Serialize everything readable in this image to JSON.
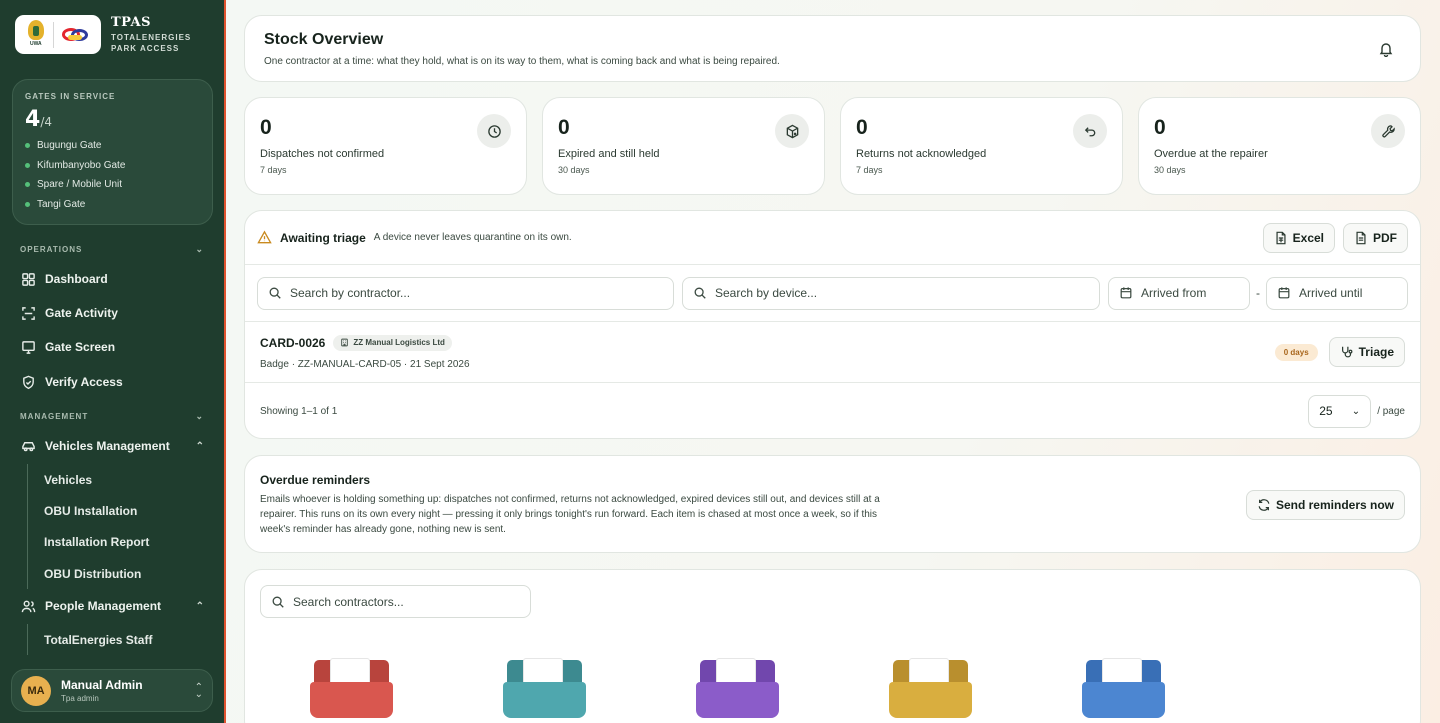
{
  "brand": {
    "title": "TPAS",
    "subtitle_line1": "TOTALENERGIES",
    "subtitle_line2": "PARK ACCESS",
    "uwa_text": "UWA"
  },
  "gates": {
    "label": "GATES IN SERVICE",
    "count": "4",
    "total": "/4",
    "items": [
      "Bugungu Gate",
      "Kifumbanyobo Gate",
      "Spare / Mobile Unit",
      "Tangi Gate"
    ]
  },
  "nav": {
    "operations_label": "OPERATIONS",
    "operations": [
      {
        "label": "Dashboard",
        "icon": "grid-icon"
      },
      {
        "label": "Gate Activity",
        "icon": "scan-icon"
      },
      {
        "label": "Gate Screen",
        "icon": "monitor-icon"
      },
      {
        "label": "Verify Access",
        "icon": "shield-check-icon"
      }
    ],
    "management_label": "MANAGEMENT",
    "vehicles_label": "Vehicles Management",
    "vehicles_items": [
      "Vehicles",
      "OBU Installation",
      "Installation Report",
      "OBU Distribution"
    ],
    "people_label": "People Management",
    "people_items": [
      "TotalEnergies Staff"
    ]
  },
  "user": {
    "initials": "MA",
    "name": "Manual Admin",
    "role": "Tpa admin"
  },
  "header": {
    "title": "Stock Overview",
    "subtitle": "One contractor at a time: what they hold, what is on its way to them, what is coming back and what is being repaired."
  },
  "stats": [
    {
      "value": "0",
      "label": "Dispatches not confirmed",
      "period": "7 days",
      "icon": "clock-icon"
    },
    {
      "value": "0",
      "label": "Expired and still held",
      "period": "30 days",
      "icon": "package-x-icon"
    },
    {
      "value": "0",
      "label": "Returns not acknowledged",
      "period": "7 days",
      "icon": "undo-icon"
    },
    {
      "value": "0",
      "label": "Overdue at the repairer",
      "period": "30 days",
      "icon": "wrench-icon"
    }
  ],
  "triage": {
    "title": "Awaiting triage",
    "description": "A device never leaves quarantine on its own.",
    "excel_label": "Excel",
    "pdf_label": "PDF",
    "search_contractor_placeholder": "Search by contractor...",
    "search_device_placeholder": "Search by device...",
    "arrived_from": "Arrived from",
    "arrived_until": "Arrived until",
    "dash": "-",
    "rows": [
      {
        "id": "CARD-0026",
        "contractor": "ZZ Manual Logistics Ltd",
        "meta": "Badge · ZZ-MANUAL-CARD-05 · 21 Sept 2026",
        "days": "0 days",
        "action": "Triage"
      }
    ],
    "showing": "Showing 1–1 of 1",
    "page_size": "25",
    "per_page": "/ page"
  },
  "reminders": {
    "title": "Overdue reminders",
    "body": "Emails whoever is holding something up: dispatches not confirmed, returns not acknowledged, expired devices still out, and devices still at a repairer. This runs on its own every night — pressing it only brings tonight's run forward. Each item is chased at most once a week, so if this week's reminder has already gone, nothing new is sent.",
    "button_label": "Send reminders now"
  },
  "contractors": {
    "search_placeholder": "Search contractors...",
    "folder_colors": [
      "#d9574f",
      "#4fa7ae",
      "#8b5cc9",
      "#d9ae3f",
      "#4c86d1"
    ]
  },
  "colors": {
    "sidebar": "#1f3d2e",
    "accent_stripe": "#e0532f",
    "gate_dot": "#55c07a",
    "days_badge_bg": "#fbead3",
    "days_badge_text": "#a8651b"
  }
}
